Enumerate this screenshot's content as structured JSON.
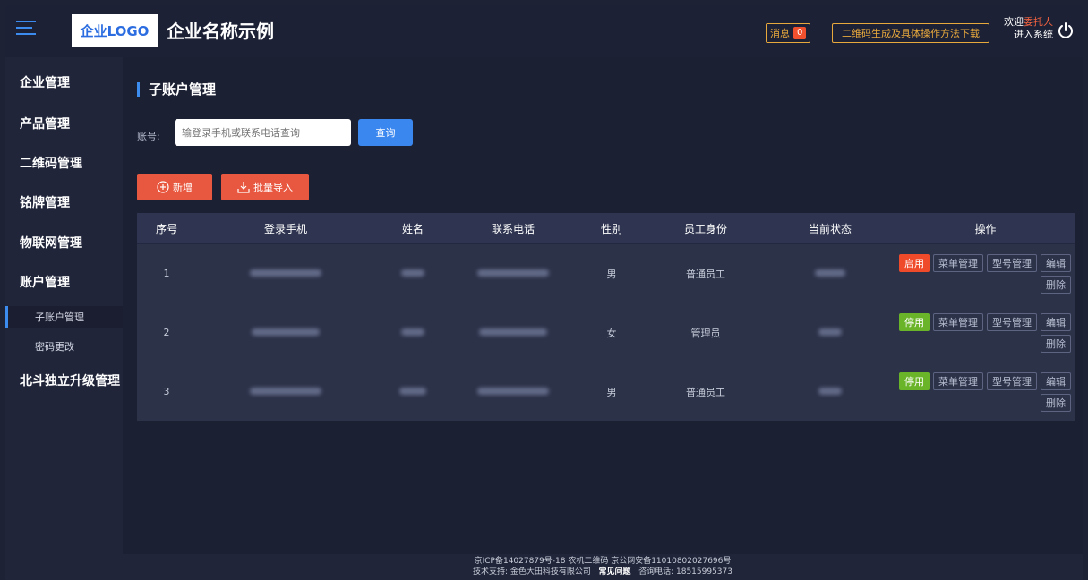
{
  "header": {
    "logo": "企业LOGO",
    "company_name": "企业名称示例",
    "message_label": "消息",
    "message_count": "0",
    "download_label": "二维码生成及具体操作方法下载",
    "welcome_prefix": "欢迎",
    "welcome_user": "委托人",
    "enter_system": "进入系统"
  },
  "sidebar": {
    "items": [
      "企业管理",
      "产品管理",
      "二维码管理",
      "铭牌管理",
      "物联网管理",
      "账户管理"
    ],
    "sub_items": [
      "子账户管理",
      "密码更改"
    ],
    "last_item": "北斗独立升级管理"
  },
  "main": {
    "title": "子账户管理",
    "account_label": "账号:",
    "search_placeholder": "输登录手机或联系电话查询",
    "query_button": "查询",
    "add_button": "新增",
    "import_button": "批量导入",
    "columns": [
      "序号",
      "登录手机",
      "姓名",
      "联系电话",
      "性别",
      "员工身份",
      "当前状态",
      "操作"
    ],
    "rows": [
      {
        "no": "1",
        "gender": "男",
        "role": "普通员工",
        "toggle": "启用"
      },
      {
        "no": "2",
        "gender": "女",
        "role": "管理员",
        "toggle": "停用"
      },
      {
        "no": "3",
        "gender": "男",
        "role": "普通员工",
        "toggle": "停用"
      }
    ],
    "op_menu": "菜单管理",
    "op_model": "型号管理",
    "op_edit": "编辑",
    "op_delete": "删除"
  },
  "footer": {
    "line1": "京ICP备14027879号-18 农机二维码 京公网安备11010802027696号",
    "support": "技术支持: 金色大田科技有限公司",
    "faq": "常见问题",
    "phone": "咨询电话: 18515995373"
  },
  "colors": {
    "accent": "#3c8cf0",
    "danger": "#ef4a2a",
    "success": "#6ab429",
    "warning": "#e8a93c"
  }
}
